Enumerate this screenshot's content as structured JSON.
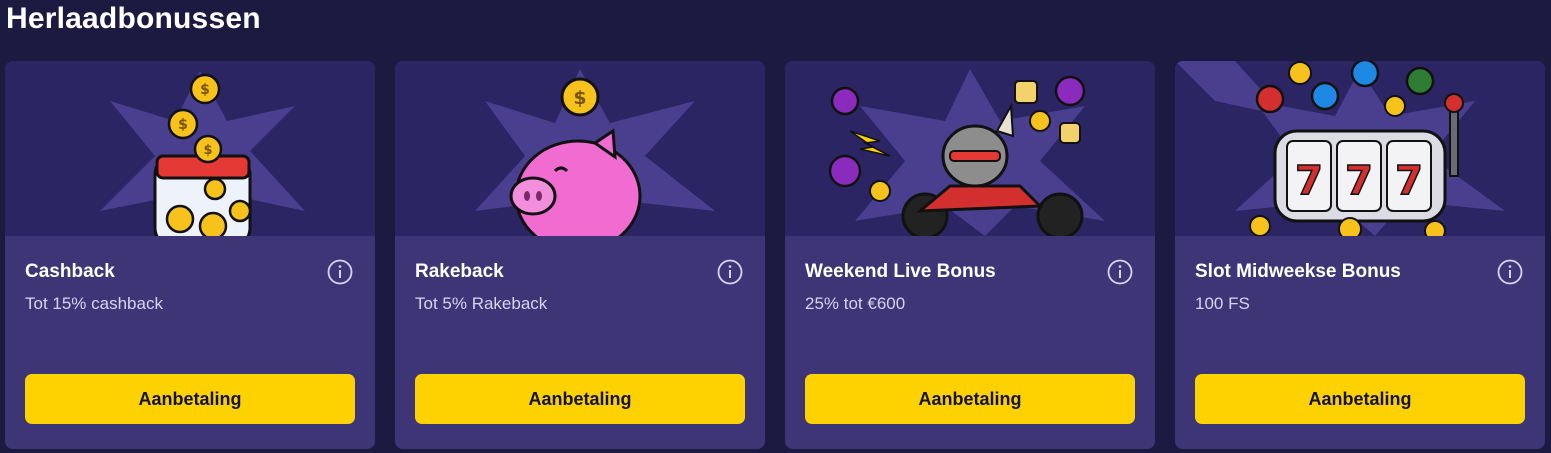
{
  "section": {
    "title": "Herlaadbonussen"
  },
  "colors": {
    "page_bg": "#1d1a42",
    "card_bg": "#3e3577",
    "art_bg": "#2b2563",
    "star": "#4a3e8f",
    "button": "#fdd200",
    "button_text": "#15122f"
  },
  "cards": [
    {
      "title": "Cashback",
      "subtitle": "Tot 15% cashback",
      "button": "Aanbetaling",
      "illustration": "coin-jar-icon"
    },
    {
      "title": "Rakeback",
      "subtitle": "Tot 5% Rakeback",
      "button": "Aanbetaling",
      "illustration": "piggy-bank-icon"
    },
    {
      "title": "Weekend Live Bonus",
      "subtitle": "25% tot €600",
      "button": "Aanbetaling",
      "illustration": "rhino-motorcycle-icon"
    },
    {
      "title": "Slot Midweekse Bonus",
      "subtitle": "100 FS",
      "button": "Aanbetaling",
      "illustration": "slot-machine-icon"
    }
  ]
}
